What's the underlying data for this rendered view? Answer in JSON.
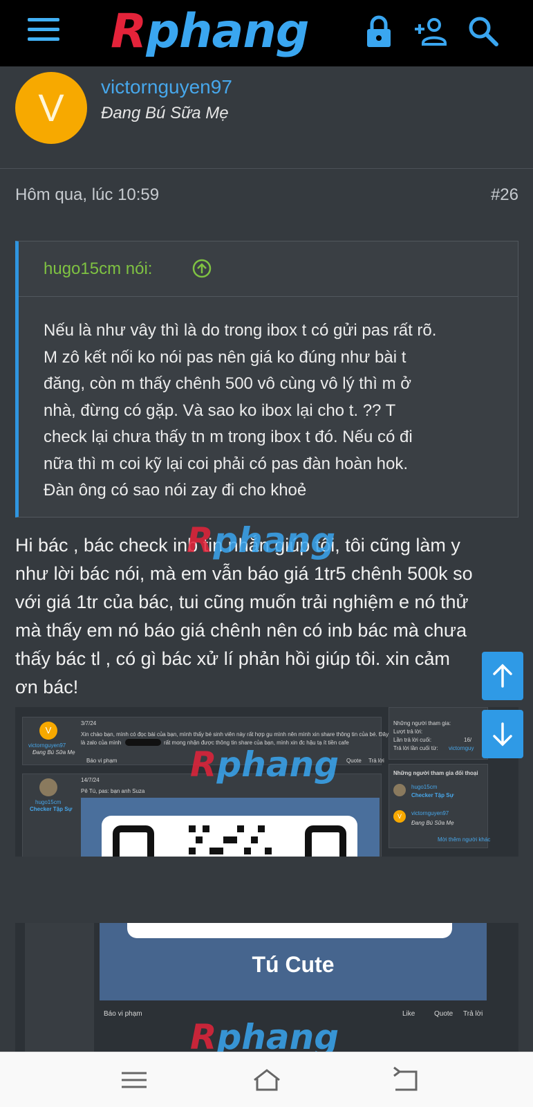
{
  "topbar": {
    "logo_first": "R",
    "logo_rest": "phang",
    "icons": [
      "menu-icon",
      "lock-icon",
      "add-user-icon",
      "search-icon"
    ]
  },
  "post": {
    "avatar_letter": "V",
    "username": "victornguyen97",
    "user_title": "Đang Bú Sữa Mẹ",
    "time": "Hôm qua, lúc 10:59",
    "number": "#26",
    "quote": {
      "author": "hugo15cm nói:",
      "lines": [
        "Nếu là như vây thì là do trong ibox t có gửi pas rất rõ.",
        "M zô kết nối ko nói pas nên giá ko đúng như bài t",
        "đăng, còn m thấy chênh 500 vô cùng vô lý thì m ở",
        "nhà, đừng có gặp. Và sao ko ibox lại cho t. ?? T",
        "check lại chưa thấy tn m trong ibox t đó. Nếu có đi",
        "nữa thì m coi kỹ lại coi phải có pas đàn hoàn hok.",
        "Đàn ông có sao nói zay đi cho khoẻ"
      ]
    },
    "message_lines": [
      "Hi bác , bác check inb tin nhắn giúp tôi, tôi cũng làm y",
      "như lời bác nói, mà em vẫn báo giá 1tr5 chênh 500k so",
      "với giá 1tr của bác, tui cũng muốn trải nghiệm e nó thử",
      "mà thấy em nó báo giá chênh nên có inb bác mà chưa",
      "thấy bác tl , có gì bác xử lí phản hồi giúp tôi. xin cảm",
      "ơn bác!"
    ]
  },
  "attachment1": {
    "msg1_date": "3/7/24",
    "msg1_user": "victornguyen97",
    "msg1_title": "Đang Bú Sữa Mẹ",
    "msg1_line1": "Xin chào bạn, mình có đọc bài của bạn, mình thấy bé sinh viên này rất hợp gu mình nên mình xin share thông tin của bé. Đây",
    "msg1_line2": "là zalo của mình",
    "msg1_line2b": "rất mong nhận được thông tin share của bạn, mình xin đc hậu tạ ít tiền cafe",
    "report": "Báo vi phạm",
    "quote_btn": "Quote",
    "reply_btn": "Trả lời",
    "msg2_date": "14/7/24",
    "msg2_user": "hugo15cm",
    "msg2_title": "Checker Tập Sự",
    "msg2_text": "Pê Tú, pas: bạn anh Suza",
    "side_title": "Những người tham gia:",
    "side_replies": "Lượt trả lời:",
    "side_last": "Lần trả lời cuối:",
    "side_last_val": "16/",
    "side_last_by": "Trả lời lần cuối từ:",
    "side_last_by_val": "victornguy",
    "participants_title": "Những người tham gia đối thoại",
    "p1_name": "hugo15cm",
    "p1_title": "Checker Tập Sự",
    "p2_name": "victornguyen97",
    "p2_title": "Đang Bú Sữa Mẹ",
    "more": "Mời thêm người khác"
  },
  "attachment2": {
    "caption": "Tú Cute",
    "report": "Báo vi phạm",
    "like": "Like",
    "quote_btn": "Quote",
    "reply_btn": "Trả lời"
  },
  "colors": {
    "accent": "#2f9ae6",
    "username": "#47a7eb",
    "quote_author": "#7fc242",
    "background": "#353a3f"
  }
}
